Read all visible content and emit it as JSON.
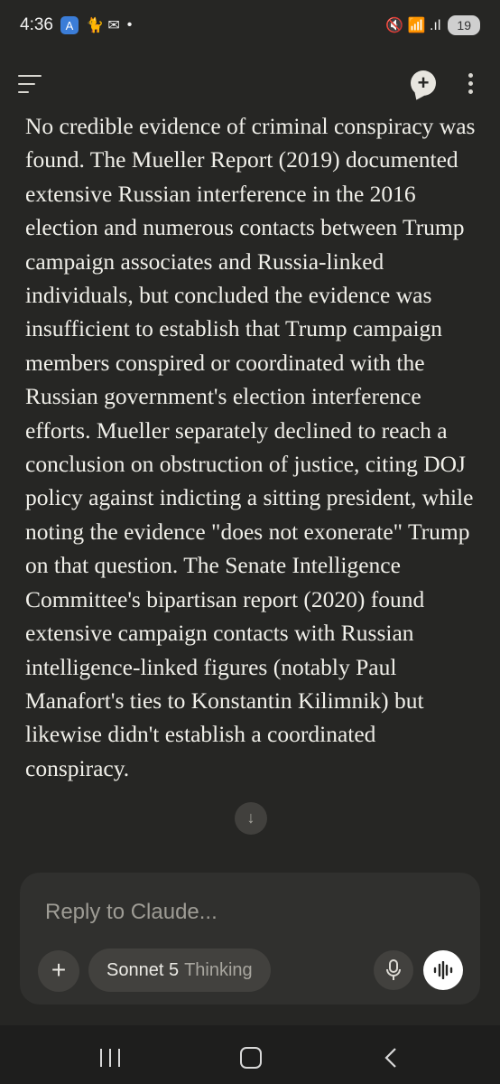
{
  "status_bar": {
    "time": "4:36",
    "app_badge": "A",
    "notif_icons": "🐈 ✉",
    "dot": "•",
    "signal_icons": "🔇 📶 .ıl",
    "battery": "19"
  },
  "header": {
    "new_chat": "+",
    "icons": [
      "menu-icon",
      "new-chat-icon",
      "more-vertical-icon"
    ]
  },
  "message": {
    "text": "No credible evidence of criminal conspiracy was found. The Mueller Report (2019) documented extensive Russian interference in the 2016 election and numerous contacts between Trump campaign associates and Russia-linked individuals, but concluded the evidence was insufficient to establish that Trump campaign members conspired or coordinated with the Russian government's election interference efforts. Mueller separately declined to reach a conclusion on obstruction of justice, citing DOJ policy against indicting a sitting president, while noting the evidence \"does not exonerate\" Trump on that question. The Senate Intelligence Committee's bipartisan report (2020) found extensive campaign contacts with Russian intelligence-linked figures (notably Paul Manafort's ties to Konstantin Kilimnik) but likewise didn't establish a coordinated conspiracy."
  },
  "scroll_button": "↓",
  "composer": {
    "placeholder": "Reply to Claude...",
    "plus": "+",
    "model_name": "Sonnet 5",
    "model_mode": "Thinking"
  },
  "colors": {
    "background": "#262624",
    "composer": "#30302e",
    "pill": "#42413e",
    "text": "#f0efe9",
    "muted": "#9e9c95"
  }
}
